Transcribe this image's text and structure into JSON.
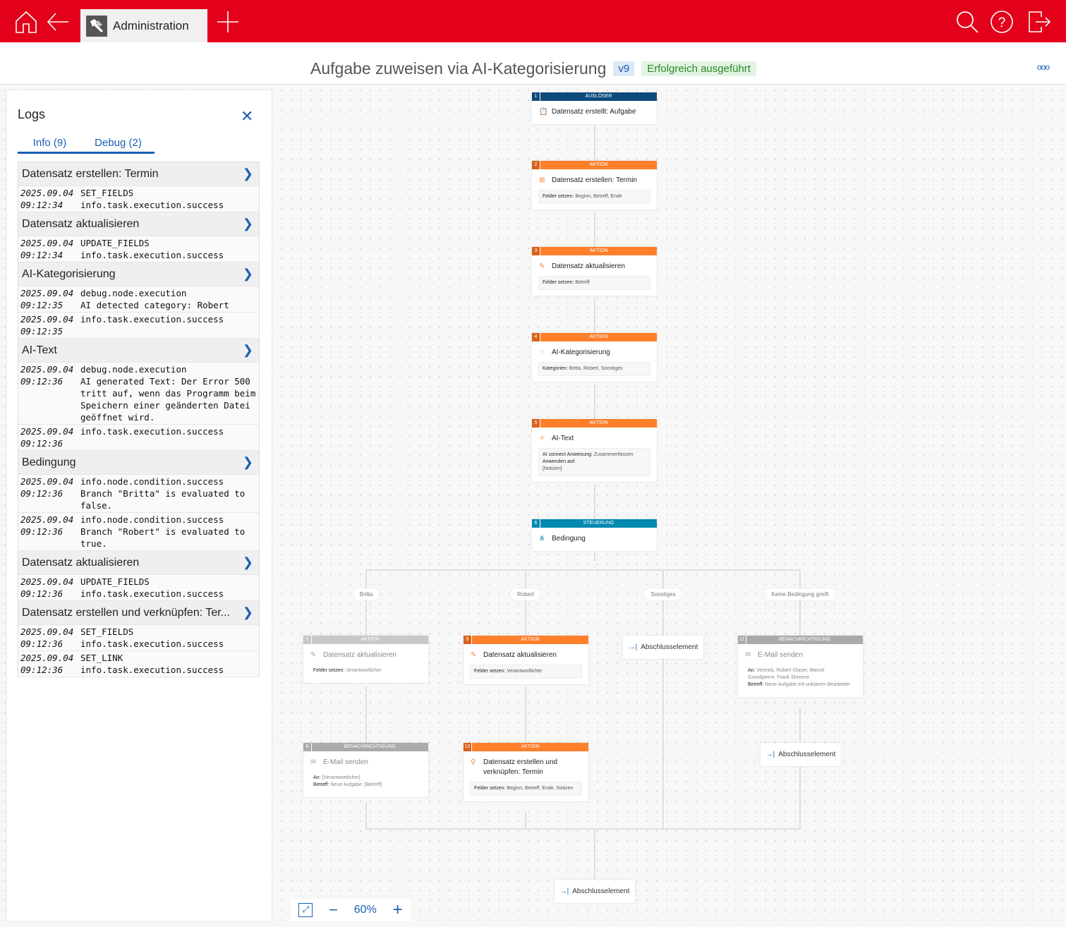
{
  "topbar": {
    "tab_label": "Administration",
    "icons": [
      "home-icon",
      "back-arrow-icon",
      "add-tab-icon",
      "search-icon",
      "help-icon",
      "logout-icon"
    ]
  },
  "header": {
    "title": "Aufgabe zuweisen via AI-Kategorisierung",
    "version": "v9",
    "status": "Erfolgreich ausgeführt",
    "more": "ooo"
  },
  "logs": {
    "title": "Logs",
    "tabs": [
      {
        "label": "Info (9)"
      },
      {
        "label": "Debug (2)"
      }
    ],
    "entries": [
      {
        "title": "Datensatz erstellen: Termin",
        "rows": [
          {
            "date": "2025.09.04",
            "time": "09:12:34",
            "lines": [
              "SET_FIELDS",
              "info.task.execution.success"
            ]
          }
        ]
      },
      {
        "title": "Datensatz aktualisieren",
        "rows": [
          {
            "date": "2025.09.04",
            "time": "09:12:34",
            "lines": [
              "UPDATE_FIELDS",
              "info.task.execution.success"
            ]
          }
        ]
      },
      {
        "title": "AI-Kategorisierung",
        "rows": [
          {
            "date": "2025.09.04",
            "time": "09:12:35",
            "lines": [
              "debug.node.execution",
              "AI detected category: Robert"
            ]
          },
          {
            "date": "2025.09.04",
            "time": "09:12:35",
            "lines": [
              "info.task.execution.success"
            ]
          }
        ]
      },
      {
        "title": "AI-Text",
        "rows": [
          {
            "date": "2025.09.04",
            "time": "09:12:36",
            "lines": [
              "debug.node.execution",
              "AI generated Text: Der Error 500 tritt auf, wenn das Programm beim Speichern einer geänderten Datei geöffnet wird."
            ]
          },
          {
            "date": "2025.09.04",
            "time": "09:12:36",
            "lines": [
              "info.task.execution.success"
            ]
          }
        ]
      },
      {
        "title": "Bedingung",
        "rows": [
          {
            "date": "2025.09.04",
            "time": "09:12:36",
            "lines": [
              "info.node.condition.success",
              "Branch \"Britta\" is evaluated to false."
            ]
          },
          {
            "date": "2025.09.04",
            "time": "09:12:36",
            "lines": [
              "info.node.condition.success",
              "Branch \"Robert\" is evaluated to true."
            ]
          }
        ]
      },
      {
        "title": "Datensatz aktualisieren",
        "rows": [
          {
            "date": "2025.09.04",
            "time": "09:12:36",
            "lines": [
              "UPDATE_FIELDS",
              "info.task.execution.success"
            ]
          }
        ]
      },
      {
        "title": "Datensatz erstellen und verknüpfen: Ter...",
        "rows": [
          {
            "date": "2025.09.04",
            "time": "09:12:36",
            "lines": [
              "SET_FIELDS",
              "info.task.execution.success"
            ]
          },
          {
            "date": "2025.09.04",
            "time": "09:12:36",
            "lines": [
              "SET_LINK",
              "info.task.execution.success"
            ]
          }
        ]
      }
    ]
  },
  "colors": {
    "trigger": "#0d4a7e",
    "action": "#ff7f2a",
    "control": "#0089b0",
    "inactive": "#c8c8c8",
    "notify_inactive": "#aaaaaa"
  },
  "nodes": [
    {
      "id": "1",
      "num": "1",
      "category": "AUSLÖSER",
      "kind": "trigger",
      "icon": "clipboard-icon",
      "glyph": "📋",
      "title": "Datensatz erstellt: Aufgabe",
      "details": []
    },
    {
      "id": "2",
      "num": "2",
      "category": "AKTION",
      "kind": "action",
      "icon": "record-add-icon",
      "glyph": "⊞",
      "title": "Datensatz erstellen: Termin",
      "details": [
        {
          "label": "Felder setzen:",
          "value": "Beginn, Betreff, Ende"
        }
      ]
    },
    {
      "id": "3",
      "num": "3",
      "category": "AKTION",
      "kind": "action",
      "icon": "pencil-icon",
      "glyph": "✎",
      "title": "Datensatz aktualisieren",
      "details": [
        {
          "label": "Felder setzen:",
          "value": "Betreff"
        }
      ]
    },
    {
      "id": "4",
      "num": "4",
      "category": "AKTION",
      "kind": "action",
      "icon": "categorize-icon",
      "glyph": "⁘",
      "title": "AI-Kategorisierung",
      "details": [
        {
          "label": "Kategorien:",
          "value": "Britta, Robert, Sonstiges"
        }
      ]
    },
    {
      "id": "5",
      "num": "5",
      "category": "AKTION",
      "kind": "action",
      "icon": "magic-wand-icon",
      "glyph": "✧",
      "title": "AI-Text",
      "details": [
        {
          "label": "AI connect Anweisung:",
          "value": "Zusammenfassen"
        },
        {
          "label": "Anwenden auf:",
          "value": ""
        },
        {
          "label": "",
          "value": "[Notizen]"
        }
      ]
    },
    {
      "id": "6",
      "num": "6",
      "category": "STEUERUNG",
      "kind": "control",
      "icon": "branch-icon",
      "glyph": "⋔",
      "title": "Bedingung",
      "details": []
    },
    {
      "id": "7",
      "num": "7",
      "category": "AKTION",
      "kind": "inactive",
      "icon": "pencil-icon",
      "glyph": "✎",
      "title": "Datensatz aktualisieren",
      "details": [
        {
          "label": "Felder setzen:",
          "value": "Verantwortlicher"
        }
      ]
    },
    {
      "id": "9",
      "num": "9",
      "category": "AKTION",
      "kind": "action",
      "icon": "pencil-icon",
      "glyph": "✎",
      "title": "Datensatz aktualisieren",
      "details": [
        {
          "label": "Felder setzen:",
          "value": "Verantwortlicher"
        }
      ]
    },
    {
      "id": "11",
      "num": "11",
      "category": "BENACHRICHTIGUNG",
      "kind": "notify_inactive",
      "icon": "mail-icon",
      "glyph": "✉",
      "title": "E-Mail senden",
      "details": [
        {
          "label": "An:",
          "value": "Vertrieb, Robert Glaser, Marcel Grandpierre, Frank Shreeve"
        },
        {
          "label": "Betreff:",
          "value": "Neue Aufgabe mit unklarem Bearbeiter"
        }
      ]
    },
    {
      "id": "8",
      "num": "8",
      "category": "BENACHRICHTIGUNG",
      "kind": "notify_inactive",
      "icon": "mail-icon",
      "glyph": "✉",
      "title": "E-Mail senden",
      "details": [
        {
          "label": "An:",
          "value": "[Verantwortlicher]"
        },
        {
          "label": "Betreff:",
          "value": "Neue Aufgabe: [Betreff]"
        }
      ]
    },
    {
      "id": "10",
      "num": "10",
      "category": "AKTION",
      "kind": "action",
      "icon": "link-add-icon",
      "glyph": "⚲",
      "title": "Datensatz erstellen und verknüpfen: Termin",
      "details": [
        {
          "label": "Felder setzen:",
          "value": "Beginn, Betreff, Ende, Notizen"
        }
      ]
    }
  ],
  "branches": [
    "Britta",
    "Robert",
    "Sonstiges",
    "Keine Bedingung greift"
  ],
  "end_label": "Abschlusselement",
  "zoom": {
    "level": "60%"
  }
}
